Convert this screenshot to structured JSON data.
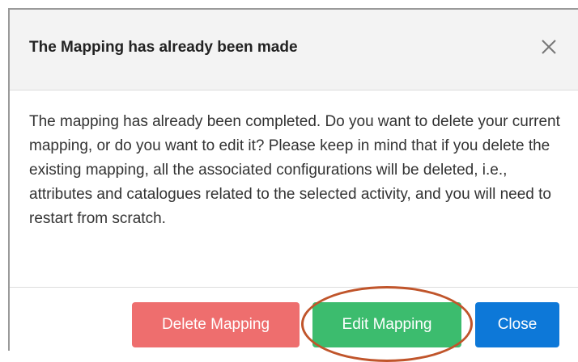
{
  "dialog": {
    "title": "The Mapping has already been made",
    "close_icon": "close-icon",
    "body_text": "The mapping has already been completed. Do you want to delete your current mapping, or do you want to edit it? Please keep in mind that if you delete the existing mapping, all the associated configurations will be deleted, i.e., attributes and catalogues related to the selected activity, and you will need to restart from scratch.",
    "buttons": {
      "delete_label": "Delete Mapping",
      "edit_label": "Edit Mapping",
      "close_label": "Close"
    }
  },
  "colors": {
    "header_bg": "#f3f3f3",
    "delete_button": "#ee6e6e",
    "edit_button": "#3cbc6e",
    "close_button": "#0d78d8",
    "highlight_ring": "#c0552b"
  }
}
